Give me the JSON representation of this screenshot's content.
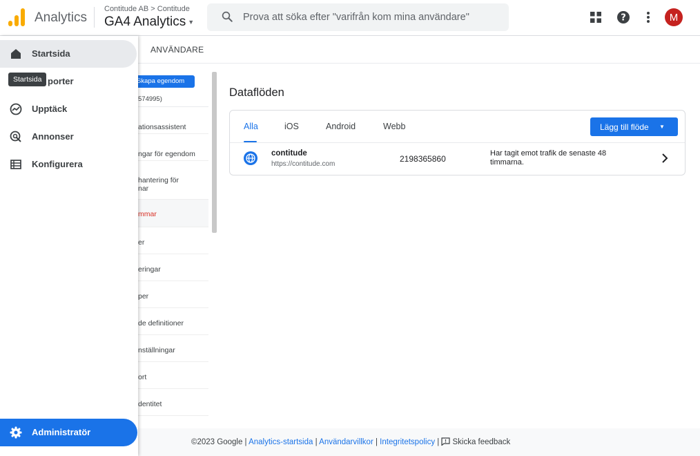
{
  "header": {
    "brand": "Analytics",
    "breadcrumb": "Contitude AB > Contitude",
    "property": "GA4 Analytics",
    "search_placeholder": "Prova att söka efter \"varifrån kom mina användare\"",
    "avatar_letter": "M",
    "colors": {
      "accent": "#1a73e8",
      "logo": "#f9ab00",
      "avatar": "#c5221f"
    }
  },
  "nav": {
    "items": [
      {
        "label": "Startsida",
        "icon": "home-icon"
      },
      {
        "label": "Rapporter",
        "icon": "reports-icon"
      },
      {
        "label": "Upptäck",
        "icon": "explore-icon"
      },
      {
        "label": "Annonser",
        "icon": "advertising-icon"
      },
      {
        "label": "Konfigurera",
        "icon": "configure-icon"
      }
    ],
    "rapporter_visible": "porter",
    "tooltip": "Startsida",
    "admin": "Administratör"
  },
  "admin": {
    "tab_label": "ANVÄNDARE",
    "create_property": "Skapa egendom",
    "property_id": "574995)",
    "column_items": [
      "ationsassistent",
      "ngar för egendom",
      "hantering för",
      "nar",
      "mmar",
      "er",
      "eringar",
      "per",
      "de definitioner",
      "nställningar",
      "ort",
      "dentitet"
    ]
  },
  "main": {
    "title": "Dataflöden",
    "tabs": [
      "Alla",
      "iOS",
      "Android",
      "Webb"
    ],
    "add_stream": "Lägg till flöde",
    "stream": {
      "name": "contitude",
      "url": "https://contitude.com",
      "id": "2198365860",
      "status": "Har tagit emot trafik de senaste 48 timmarna."
    }
  },
  "footer": {
    "copyright": "©2023 Google",
    "sep": " | ",
    "links": [
      "Analytics-startsida",
      "Användarvillkor",
      "Integritetspolicy"
    ],
    "feedback": "Skicka feedback"
  }
}
